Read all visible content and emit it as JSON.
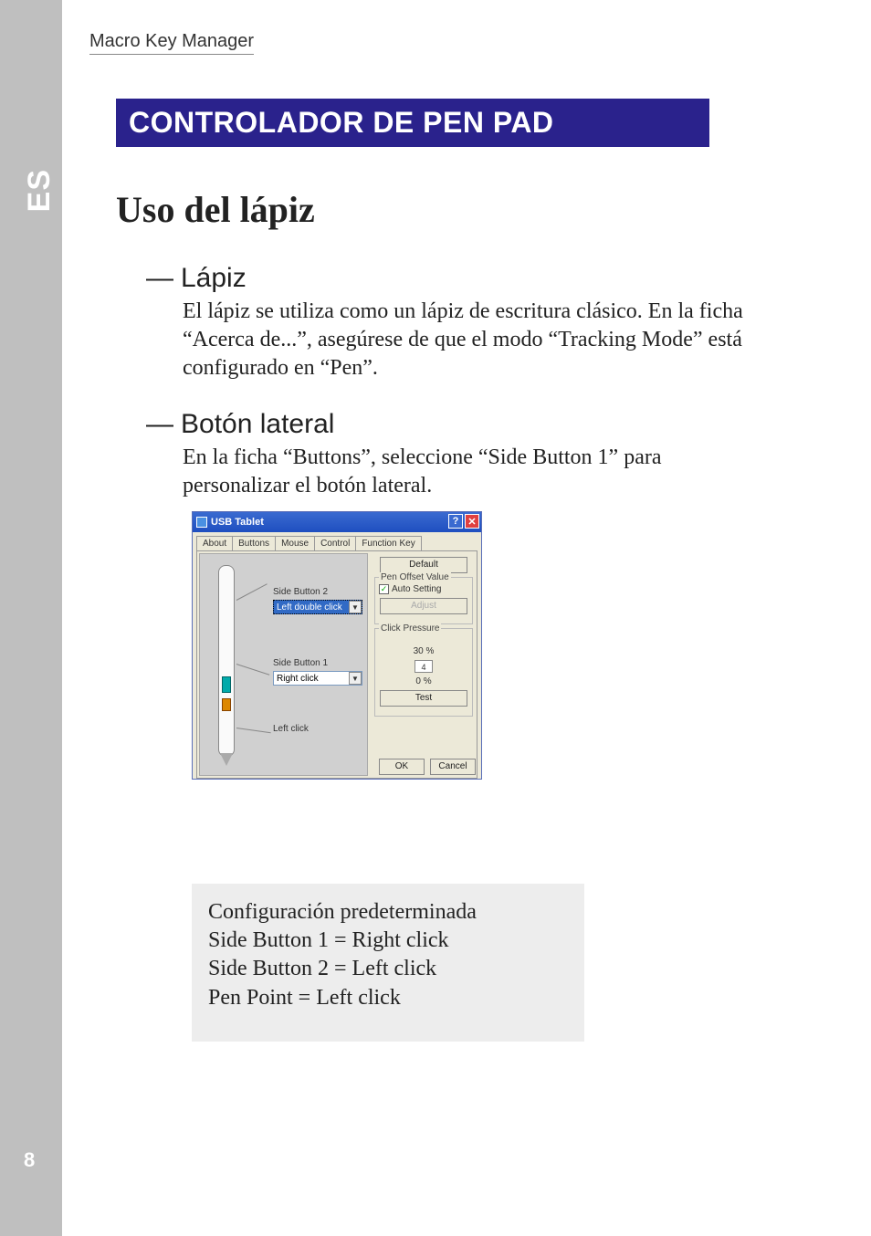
{
  "header": {
    "title": "Macro Key Manager"
  },
  "lang_tab": "ES",
  "page_number": "8",
  "banner": "CONTROLADOR DE PEN PAD",
  "section_heading": "Uso del lápiz",
  "item1": {
    "dash": "—",
    "label": "Lápiz",
    "body": "El lápiz se utiliza como un lápiz de escritura clásico. En la ficha “Acerca de...”, asegúrese de que el modo “Tracking Mode” está configurado en “Pen”."
  },
  "item2": {
    "dash": "—",
    "label": "Botón lateral",
    "body": "En la ficha “Buttons”, seleccione “Side Button 1” para personalizar el botón lateral."
  },
  "dialog": {
    "title": "USB Tablet",
    "help": "?",
    "close": "✕",
    "tabs": {
      "about": "About",
      "buttons": "Buttons",
      "mouse": "Mouse",
      "control": "Control",
      "fkey": "Function Key"
    },
    "side_button2_label": "Side Button 2",
    "side_button2_value": "Left double click",
    "side_button1_label": "Side Button 1",
    "side_button1_value": "Right click",
    "left_click_label": "Left click",
    "default_btn": "Default",
    "offset_group": "Pen Offset Value",
    "auto_setting": "Auto Setting",
    "adjust_btn": "Adjust",
    "pressure_group": "Click Pressure",
    "pressure_top": "30 %",
    "pressure_box": "4",
    "pressure_bot": "0 %",
    "test_btn": "Test",
    "ok": "OK",
    "cancel": "Cancel"
  },
  "config_box": {
    "l1": "Configuración predeterminada",
    "l2": "Side Button 1 = Right click",
    "l3": "Side Button 2 = Left click",
    "l4": "Pen Point = Left click"
  }
}
